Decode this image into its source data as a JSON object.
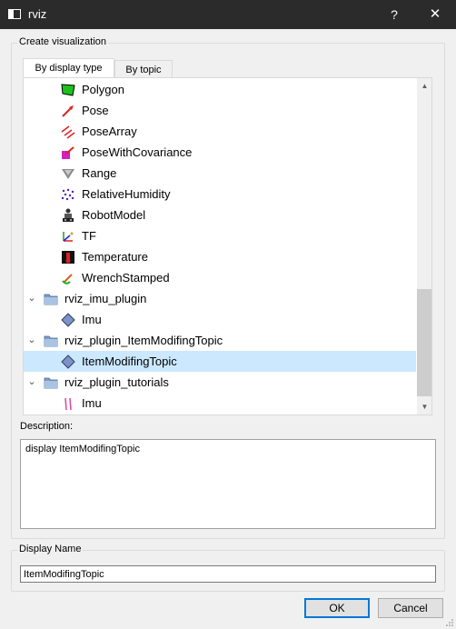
{
  "window": {
    "title": "rviz",
    "help_label": "?",
    "close_label": "✕"
  },
  "create_group": {
    "label": "Create visualization"
  },
  "tabs": [
    {
      "label": "By display type",
      "active": true
    },
    {
      "label": "By topic",
      "active": false
    }
  ],
  "tree": {
    "rows": [
      {
        "label": "Polygon",
        "icon": "polygon-icon",
        "level": 2
      },
      {
        "label": "Pose",
        "icon": "pose-icon",
        "level": 2
      },
      {
        "label": "PoseArray",
        "icon": "pose-array-icon",
        "level": 2
      },
      {
        "label": "PoseWithCovariance",
        "icon": "pose-with-covariance-icon",
        "level": 2
      },
      {
        "label": "Range",
        "icon": "range-icon",
        "level": 2
      },
      {
        "label": "RelativeHumidity",
        "icon": "relative-humidity-icon",
        "level": 2
      },
      {
        "label": "RobotModel",
        "icon": "robot-model-icon",
        "level": 2
      },
      {
        "label": "TF",
        "icon": "tf-icon",
        "level": 2
      },
      {
        "label": "Temperature",
        "icon": "temperature-icon",
        "level": 2
      },
      {
        "label": "WrenchStamped",
        "icon": "wrench-stamped-icon",
        "level": 2
      },
      {
        "label": "rviz_imu_plugin",
        "icon": "folder-icon",
        "level": 1,
        "expanded": true
      },
      {
        "label": "Imu",
        "icon": "imu-diamond-icon",
        "level": 2
      },
      {
        "label": "rviz_plugin_ItemModifingTopic",
        "icon": "folder-icon",
        "level": 1,
        "expanded": true
      },
      {
        "label": "ItemModifingTopic",
        "icon": "item-modifing-topic-icon",
        "level": 2,
        "selected": true
      },
      {
        "label": "rviz_plugin_tutorials",
        "icon": "folder-icon",
        "level": 1,
        "expanded": true
      },
      {
        "label": "Imu",
        "icon": "imu-tutorial-icon",
        "level": 2
      }
    ]
  },
  "description": {
    "label": "Description:",
    "text": "display ItemModifingTopic"
  },
  "display_name": {
    "label": "Display Name",
    "value": "ItemModifingTopic"
  },
  "buttons": {
    "ok": "OK",
    "cancel": "Cancel"
  },
  "colors": {
    "selection": "#cce8ff",
    "titlebar": "#2b2b2b",
    "accent": "#0078d7"
  }
}
